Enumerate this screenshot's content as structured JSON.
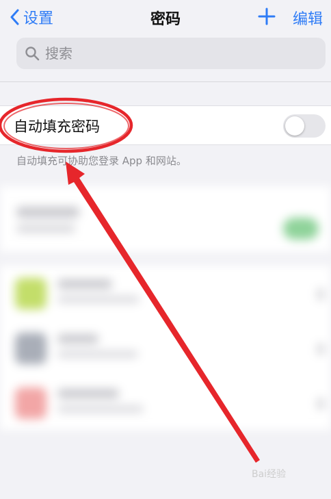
{
  "navbar": {
    "back_label": "设置",
    "title": "密码",
    "add_icon": "plus-icon",
    "edit_label": "编辑"
  },
  "search": {
    "placeholder": "搜索",
    "icon": "search-icon"
  },
  "autofill": {
    "label": "自动填充密码",
    "enabled": false,
    "footer": "自动填充可协助您登录 App 和网站。"
  },
  "watermark": "Bai经验",
  "colors": {
    "accent": "#2f7cf6",
    "annotation": "#e6262b",
    "background": "#f2f2f6"
  }
}
